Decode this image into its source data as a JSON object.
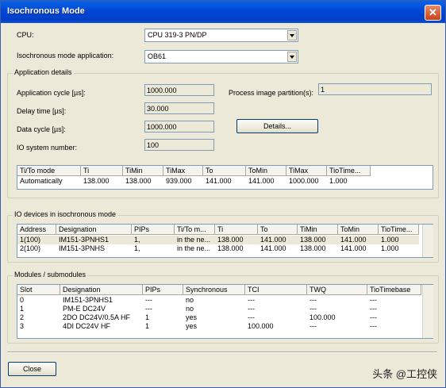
{
  "window": {
    "title": "Isochronous Mode",
    "close_glyph": "✕"
  },
  "cpu": {
    "label": "CPU:",
    "value": "CPU 319-3 PN/DP"
  },
  "app": {
    "label": "Isochronous mode application:",
    "value": "OB61"
  },
  "details": {
    "caption": "Application details",
    "app_cycle_label": "Application cycle [µs]:",
    "app_cycle": "1000.000",
    "delay_label": "Delay time [µs]:",
    "delay": "30.000",
    "data_cycle_label": "Data cycle [µs]:",
    "data_cycle": "1000.000",
    "io_sys_label": "IO system number:",
    "io_sys": "100",
    "pip_label": "Process image partition(s):",
    "pip": "1",
    "details_button": "Details...",
    "timing": {
      "headers": [
        "Ti/To mode",
        "Ti",
        "TiMin",
        "TiMax",
        "To",
        "ToMin",
        "TiMax",
        "TioTime..."
      ],
      "row": [
        "Automatically",
        "138.000",
        "138.000",
        "939.000",
        "141.000",
        "141.000",
        "1000.000",
        "1.000"
      ]
    }
  },
  "io_devices": {
    "caption": "IO devices in isochronous mode",
    "headers": [
      "Address",
      "Designation",
      "PIPs",
      "Ti/To m...",
      "Ti",
      "To",
      "TiMin",
      "ToMin",
      "TioTime..."
    ],
    "rows": [
      [
        "1(100)",
        "IM151-3PNHS1",
        "1,",
        "in the ne...",
        "138.000",
        "141.000",
        "138.000",
        "141.000",
        "1.000"
      ],
      [
        "2(100)",
        "IM151-3PNHS",
        "1,",
        "in the ne...",
        "138.000",
        "141.000",
        "138.000",
        "141.000",
        "1.000"
      ]
    ]
  },
  "modules": {
    "caption": "Modules / submodules",
    "headers": [
      "Slot",
      "Designation",
      "PIPs",
      "Synchronous",
      "TCI",
      "TWQ",
      "TioTimebase"
    ],
    "rows": [
      [
        "0",
        "IM151-3PNHS1",
        "---",
        "no",
        "---",
        "---",
        "---"
      ],
      [
        "1",
        "PM-E DC24V",
        "---",
        "no",
        "---",
        "---",
        "---"
      ],
      [
        "2",
        "2DO DC24V/0.5A HF",
        "1",
        "yes",
        "---",
        "100.000",
        "---"
      ],
      [
        "3",
        "4DI DC24V HF",
        "1",
        "yes",
        "100.000",
        "---",
        "---"
      ]
    ]
  },
  "footer": {
    "close_button": "Close",
    "watermark": "头条 @工控侠"
  }
}
